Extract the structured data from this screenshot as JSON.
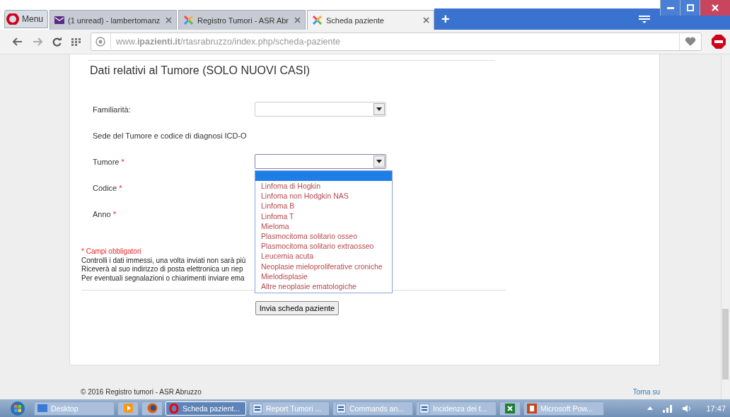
{
  "browser": {
    "menu": "Menu",
    "tabs": [
      {
        "title": "(1 unread) - lambertomanz",
        "kind": "mail",
        "selected": false
      },
      {
        "title": "Registro Tumori - ASR Abr",
        "kind": "logo",
        "selected": false
      },
      {
        "title": "Scheda paziente",
        "kind": "logo",
        "selected": true
      }
    ],
    "new_tab": "+",
    "address": "www.**ipazienti.it**/rtasrabruzzo/index.php/scheda-paziente"
  },
  "form": {
    "heading": "Dati relativi al Tumore (SOLO NUOVI CASI)",
    "fields": [
      {
        "kind": "select",
        "label": "Familiarità:",
        "focused": false
      },
      {
        "kind": "section",
        "label": "Sede del Tumore e codice di diagnosi ICD-O"
      },
      {
        "kind": "select",
        "label": "Tumore",
        "required_mark": "*",
        "focused": true,
        "open": true,
        "blank_highlighted": true,
        "options": [
          "Linfoma di Hogkin",
          "Linfoma non Hodgkin NAS",
          "Linfoma B",
          "Linfoma T",
          "Mieloma",
          "Plasmocitoma solitario osseo",
          "Plasmocitoma solitario extraosseo",
          "Leucemia acuta",
          "Neoplasie mieloproliferative croniche",
          "Mielodisplasie",
          "Altre neoplasie ematologiche"
        ]
      },
      {
        "kind": "plain",
        "label": "Codice",
        "required_mark": "*"
      },
      {
        "kind": "plain",
        "label": "Anno",
        "required_mark": "*"
      }
    ],
    "required_note": "* Campi obbligatori",
    "notes": [
      "Controlli i dati immessi, una volta inviati non sarà più",
      "Riceverà al suo indirizzo di posta elettronica un riep",
      "Per eventuali segnalazioni o chiarimenti inviare ema"
    ],
    "submit": "Invia scheda paziente"
  },
  "footer": {
    "copyright": "© 2016 Registro tumori - ASR Abruzzo",
    "back_to_top": "Torna su"
  },
  "taskbar": {
    "items": [
      {
        "kind": "window",
        "label": "Desktop",
        "selected": false
      },
      {
        "kind": "media",
        "selected": false
      },
      {
        "kind": "firefox",
        "selected": false
      },
      {
        "kind": "opera",
        "label": "Scheda pazient...",
        "selected": true
      },
      {
        "kind": "doc",
        "label": "Report Tumori ...",
        "selected": false
      },
      {
        "kind": "doc",
        "label": "Commands an...",
        "selected": false
      },
      {
        "kind": "doc",
        "label": "Incidenza dei t...",
        "selected": false
      },
      {
        "kind": "sheet",
        "selected": false
      },
      {
        "kind": "slides",
        "label": "Microsoft Pow...",
        "selected": false
      }
    ],
    "clock": "17:47"
  }
}
